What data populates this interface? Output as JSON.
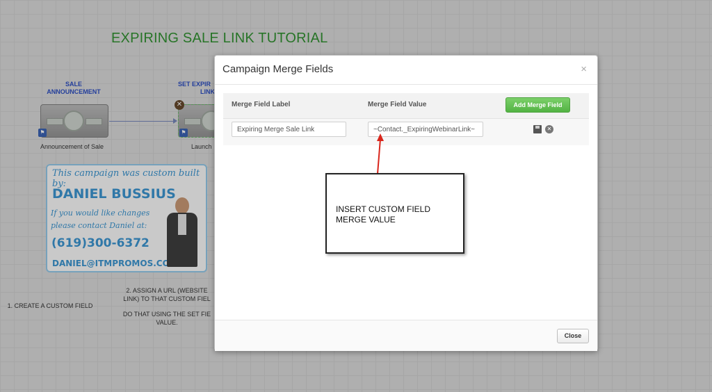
{
  "canvas": {
    "title": "EXPIRING SALE LINK TUTORIAL",
    "node1": {
      "label_line1": "SALE",
      "label_line2": "ANNOUNCEMENT",
      "caption": "Announcement of Sale"
    },
    "node2": {
      "label_line1": "SET EXPIR",
      "label_line2": "LINK",
      "caption": "Launch"
    },
    "promo": {
      "line1": "This campaign was custom built by:",
      "name": "DANIEL BUSSIUS",
      "line2": "If you would like changes",
      "line3": "please contact Daniel at:",
      "phone": "(619)300-6372",
      "email": "DANIEL@ITMPROMOS.COM"
    },
    "step1": "1. CREATE A CUSTOM FIELD",
    "step2_line1": "2. ASSIGN A URL (WEBSITE",
    "step2_line2": "LINK) TO THAT CUSTOM FIEL",
    "step2_line3": "DO THAT USING THE SET FIE",
    "step2_line4": "VALUE."
  },
  "modal": {
    "title": "Campaign Merge Fields",
    "close_x": "×",
    "col_label": "Merge Field Label",
    "col_value": "Merge Field Value",
    "add_button": "Add Merge Field",
    "row": {
      "label_value": "Expiring Merge Sale Link",
      "value_value": "~Contact._ExpiringWebinarLink~"
    },
    "close_button": "Close"
  },
  "callout": {
    "line1": "INSERT CUSTOM FIELD",
    "line2": "MERGE VALUE"
  },
  "colors": {
    "title_green": "#1f8a1f",
    "add_button_green": "#5cb85c",
    "arrow_red": "#d9261c"
  }
}
